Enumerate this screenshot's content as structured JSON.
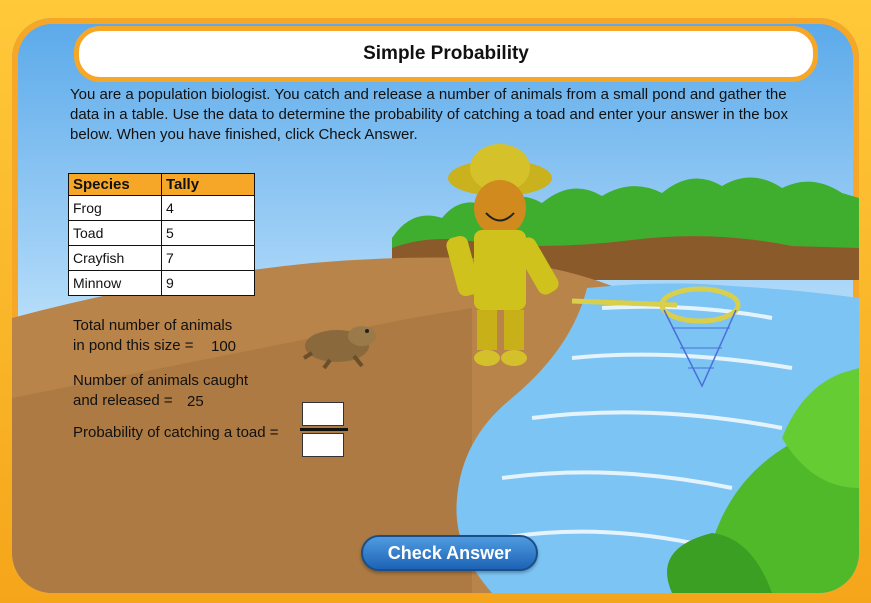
{
  "title": "Simple Probability",
  "instructions": "You are a population biologist. You catch and release a number of animals from a small pond and gather the data in a table. Use the data to determine the probability of catching a toad and enter your answer in the box below. When you have finished, click Check Answer.",
  "table": {
    "headers": [
      "Species",
      "Tally"
    ],
    "rows": [
      {
        "species": "Frog",
        "tally": "4"
      },
      {
        "species": "Toad",
        "tally": "5"
      },
      {
        "species": "Crayfish",
        "tally": "7"
      },
      {
        "species": "Minnow",
        "tally": "9"
      }
    ]
  },
  "total": {
    "label_line1": "Total number of animals",
    "label_line2": "in pond this size =",
    "value": "100"
  },
  "caught": {
    "label_line1": "Number of animals caught",
    "label_line2": "and released =",
    "value": "25"
  },
  "probability": {
    "label": "Probability of catching a toad =",
    "numerator": "",
    "denominator": ""
  },
  "check_button": "Check Answer",
  "colors": {
    "frame": "#f7a728",
    "header": "#f7a728",
    "button": "#1e63b6",
    "water": "#7cc4f4",
    "shore": "#b8844a"
  }
}
